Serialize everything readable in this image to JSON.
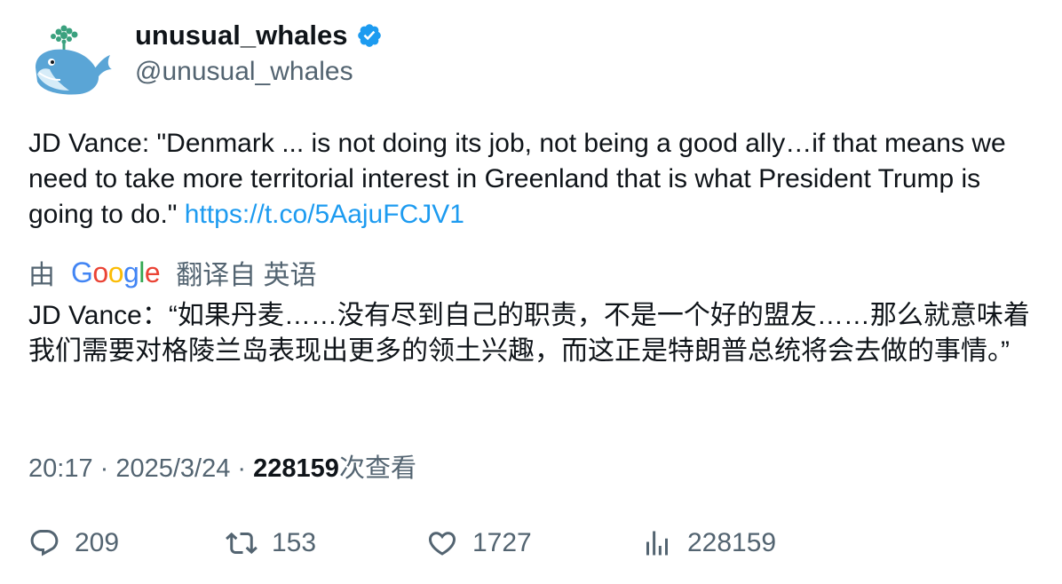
{
  "author": {
    "display_name": "unusual_whales",
    "handle": "@unusual_whales",
    "verified_icon": "verified-badge-icon",
    "avatar_icon": "whale-avatar"
  },
  "tweet": {
    "text": "JD Vance: \"Denmark ... is not doing its job, not being a good ally…if that means we need to take more territorial interest in Greenland that is what President Trump is going to do.\" ",
    "link": "https://t.co/5AajuFCJV1"
  },
  "translation": {
    "by_label": "由",
    "provider": "Google",
    "from_label": "翻译自 英语",
    "text": "JD Vance：“如果丹麦……没有尽到自己的职责，不是一个好的盟友……那么就意味着我们需要对格陵兰岛表现出更多的领土兴趣，而这正是特朗普总统将会去做的事情。”"
  },
  "meta": {
    "time": "20:17",
    "separator": " · ",
    "date": "2025/3/24",
    "views": "228159",
    "views_suffix": "次查看"
  },
  "actions": {
    "replies": "209",
    "retweets": "153",
    "likes": "1727",
    "views": "228159"
  },
  "colors": {
    "accent": "#1d9bf0",
    "text": "#0f1419",
    "muted": "#536471"
  }
}
